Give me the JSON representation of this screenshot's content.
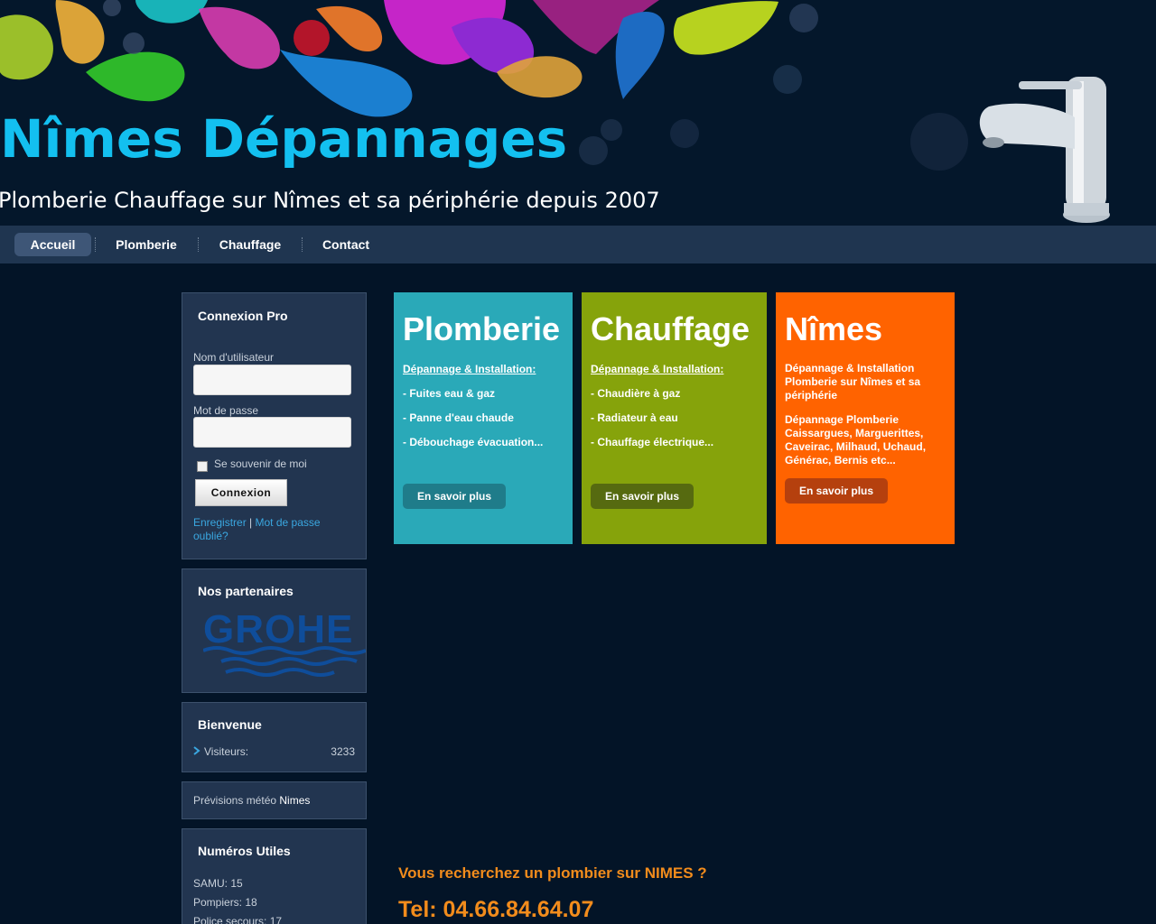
{
  "header": {
    "title": "Nîmes Dépannages",
    "tagline": "Plomberie Chauffage sur Nîmes et sa périphérie depuis 2007"
  },
  "nav": {
    "items": [
      {
        "label": "Accueil",
        "active": true
      },
      {
        "label": "Plomberie",
        "active": false
      },
      {
        "label": "Chauffage",
        "active": false
      },
      {
        "label": "Contact",
        "active": false
      }
    ]
  },
  "login": {
    "title": "Connexion Pro",
    "username_label": "Nom d'utilisateur",
    "username_value": "",
    "password_label": "Mot de passe",
    "password_value": "",
    "remember_label": "Se souvenir de moi",
    "submit_label": "Connexion",
    "register_link": "Enregistrer",
    "separator": "|",
    "forgot_link": "Mot de passe oublié?"
  },
  "partners": {
    "title": "Nos partenaires",
    "logo_text": "GROHE"
  },
  "welcome": {
    "title": "Bienvenue",
    "visitors_label": "Visiteurs:",
    "visitors_count": "3233"
  },
  "weather": {
    "label": "Prévisions météo",
    "city": "Nimes"
  },
  "numbers": {
    "title": "Numéros Utiles",
    "items": [
      "SAMU: 15",
      "Pompiers: 18",
      "Police secours: 17"
    ]
  },
  "panels": [
    {
      "title": "Plomberie",
      "subtitle": "Dépannage & Installation:",
      "lines": [
        "- Fuites eau & gaz",
        "- Panne d'eau chaude",
        "- Débouchage évacuation..."
      ],
      "button": "En savoir plus"
    },
    {
      "title": "Chauffage",
      "subtitle": "Dépannage & Installation:",
      "lines": [
        "- Chaudière à gaz",
        "- Radiateur à eau",
        "- Chauffage électrique..."
      ],
      "button": "En savoir plus"
    },
    {
      "title": "Nîmes",
      "para1": "Dépannage & Installation Plomberie sur Nîmes et sa périphérie",
      "para2": "Dépannage Plomberie Caissargues, Marguerittes, Caveirac, Milhaud, Uchaud, Générac, Bernis etc...",
      "button": "En savoir plus"
    }
  ],
  "content": {
    "cta": "Vous recherchez un plombier sur NIMES ?",
    "tel": "Tel: 04.66.84.64.07"
  },
  "colors": {
    "background": "#031427",
    "nav": "#1f3550",
    "plomberie": "#2aa9b8",
    "chauffage": "#86a30b",
    "nimes": "#ff6300",
    "accent_orange": "#f28c1c",
    "title_blue": "#13c0f0"
  },
  "icons": {
    "faucet": "faucet-icon",
    "bullet": "chevron-right-icon"
  }
}
